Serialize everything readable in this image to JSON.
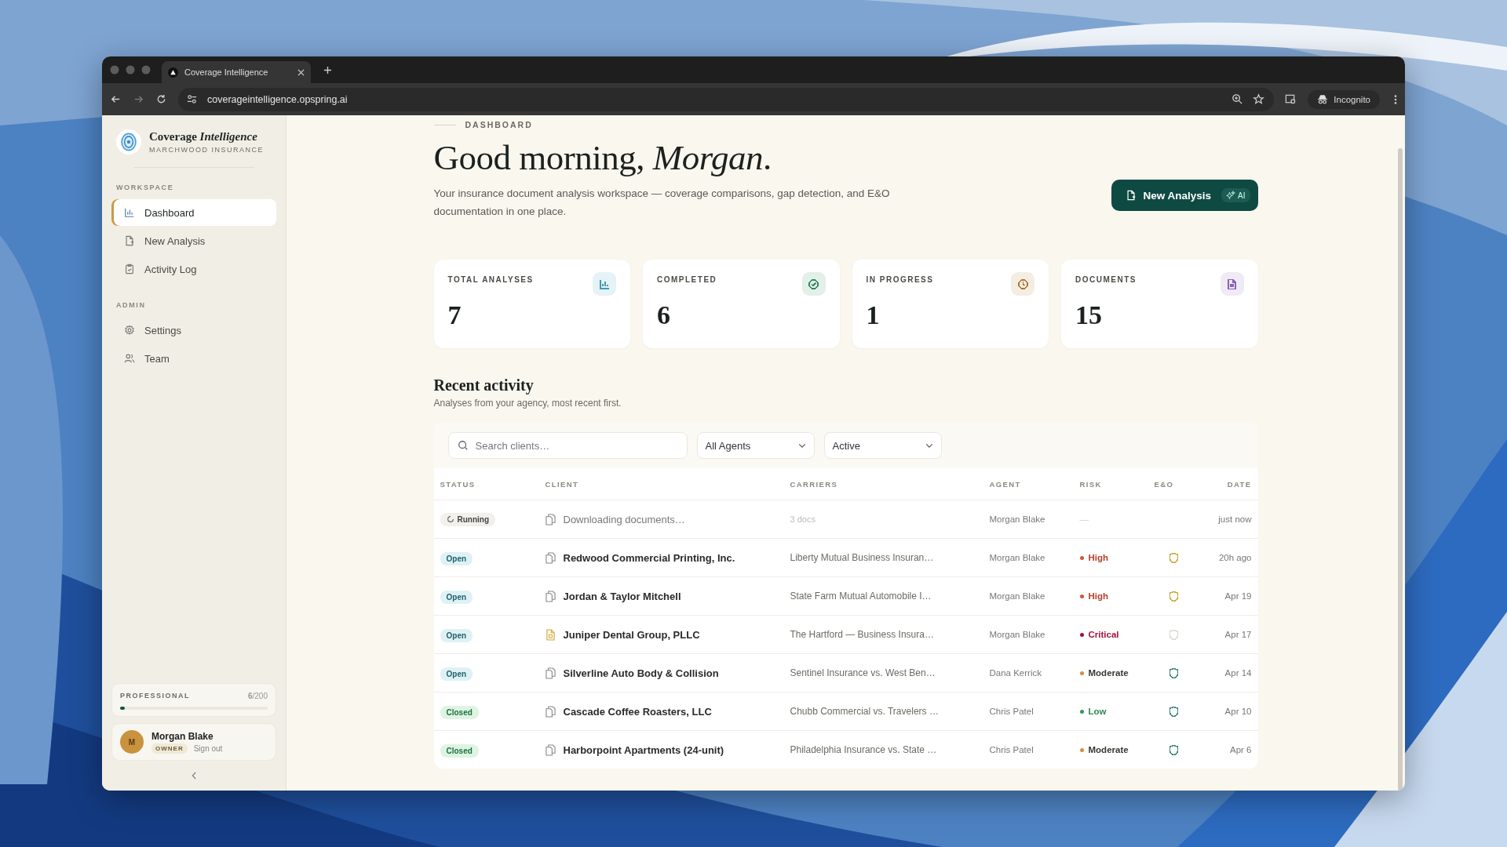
{
  "browser": {
    "tab_title": "Coverage Intelligence",
    "url": "coverageintelligence.opspring.ai",
    "incognito_label": "Incognito"
  },
  "sidebar": {
    "brand_name": "Coverage *Intelligence*",
    "brand_subtitle": "MARCHWOOD INSURANCE",
    "sections": [
      {
        "title": "WORKSPACE",
        "items": [
          {
            "label": "Dashboard",
            "kind": "chart",
            "selected": true
          },
          {
            "label": "New Analysis",
            "kind": "file",
            "selected": false
          },
          {
            "label": "Activity Log",
            "kind": "clipboard",
            "selected": false
          }
        ]
      },
      {
        "title": "ADMIN",
        "items": [
          {
            "label": "Settings",
            "kind": "gear",
            "selected": false
          },
          {
            "label": "Team",
            "kind": "users",
            "selected": false
          }
        ]
      }
    ],
    "plan": {
      "name": "PROFESSIONAL",
      "usage": "**6**/200",
      "level": 0.03
    },
    "user": {
      "initial": "M",
      "name": "Morgan Blake",
      "role": "OWNER",
      "sign_out": "Sign out"
    }
  },
  "page": {
    "breadcrumb": "DASHBOARD",
    "greeting": "Good morning, *Morgan*.",
    "description": "Your insurance document analysis workspace — coverage comparisons, gap detection, and E&O documentation in one place.",
    "new_analysis_button": "New Analysis",
    "ai_badge": "AI"
  },
  "stats": [
    {
      "label": "TOTAL ANALYSES",
      "value": "7",
      "kind": "chart",
      "color": "#3f9ab8"
    },
    {
      "label": "COMPLETED",
      "value": "6",
      "kind": "check",
      "color": "#2f8a5a"
    },
    {
      "label": "IN PROGRESS",
      "value": "1",
      "kind": "clock",
      "color": "#b0782e"
    },
    {
      "label": "DOCUMENTS",
      "value": "15",
      "kind": "doc",
      "color": "#8a62b8"
    }
  ],
  "recent_activity": {
    "title": "Recent activity",
    "subtitle": "Analyses from your agency, most recent first.",
    "search": {
      "placeholder": "Search clients…"
    },
    "agent_filter": "All Agents",
    "status_filter": "Active",
    "table": {
      "columns": [
        "STATUS",
        "CLIENT",
        "CARRIERS",
        "AGENT",
        "RISK",
        "E&O",
        "DATE"
      ],
      "rows": [
        {
          "status": {
            "label": "Running",
            "kind": "running"
          },
          "client": {
            "name": "Downloading documents…",
            "kind": "copies"
          },
          "carriers": "3 docs",
          "agent": "Morgan Blake",
          "risk": {
            "label": "—"
          },
          "date": "just now"
        },
        {
          "status": {
            "label": "Open",
            "kind": "open"
          },
          "client": {
            "name": "Redwood Commercial Printing, Inc.",
            "kind": "copies"
          },
          "carriers": "Liberty Mutual Business Insuran…",
          "agent": "Morgan Blake",
          "risk": {
            "label": "High",
            "color": "#d2553c"
          },
          "eo": {
            "color": "#c9aa3c"
          },
          "date": "20h ago"
        },
        {
          "status": {
            "label": "Open",
            "kind": "open"
          },
          "client": {
            "name": "Jordan & Taylor Mitchell",
            "kind": "copies"
          },
          "carriers": "State Farm Mutual Automobile I…",
          "agent": "Morgan Blake",
          "risk": {
            "label": "High",
            "color": "#d2553c"
          },
          "eo": {
            "color": "#c9aa3c"
          },
          "date": "Apr 19"
        },
        {
          "status": {
            "label": "Open",
            "kind": "open"
          },
          "client": {
            "name": "Juniper Dental Group, PLLC",
            "kind": "file"
          },
          "carriers": "The Hartford — Business Insura…",
          "agent": "Morgan Blake",
          "risk": {
            "label": "Critical",
            "color": "#a3123c"
          },
          "eo": {
            "color": "#dddad2"
          },
          "date": "Apr 17"
        },
        {
          "status": {
            "label": "Open",
            "kind": "open"
          },
          "client": {
            "name": "Silverline Auto Body & Collision",
            "kind": "copies"
          },
          "carriers": "Sentinel Insurance vs. West Ben…",
          "agent": "Dana Kerrick",
          "risk": {
            "label": "Moderate",
            "color": "#d2903c"
          },
          "eo": {
            "color": "#3f8a78"
          },
          "date": "Apr 14"
        },
        {
          "status": {
            "label": "Closed",
            "kind": "closed"
          },
          "client": {
            "name": "Cascade Coffee Roasters, LLC",
            "kind": "copies"
          },
          "carriers": "Chubb Commercial vs. Travelers …",
          "agent": "Chris Patel",
          "risk": {
            "label": "Low",
            "color": "#2f9a5a"
          },
          "eo": {
            "color": "#3f8a78"
          },
          "date": "Apr 10"
        },
        {
          "status": {
            "label": "Closed",
            "kind": "closed"
          },
          "client": {
            "name": "Harborpoint Apartments (24-unit)",
            "kind": "copies"
          },
          "carriers": "Philadelphia Insurance vs. State …",
          "agent": "Chris Patel",
          "risk": {
            "label": "Moderate",
            "color": "#d2903c"
          },
          "eo": {
            "color": "#3f8a78"
          },
          "date": "Apr 6"
        }
      ]
    }
  }
}
